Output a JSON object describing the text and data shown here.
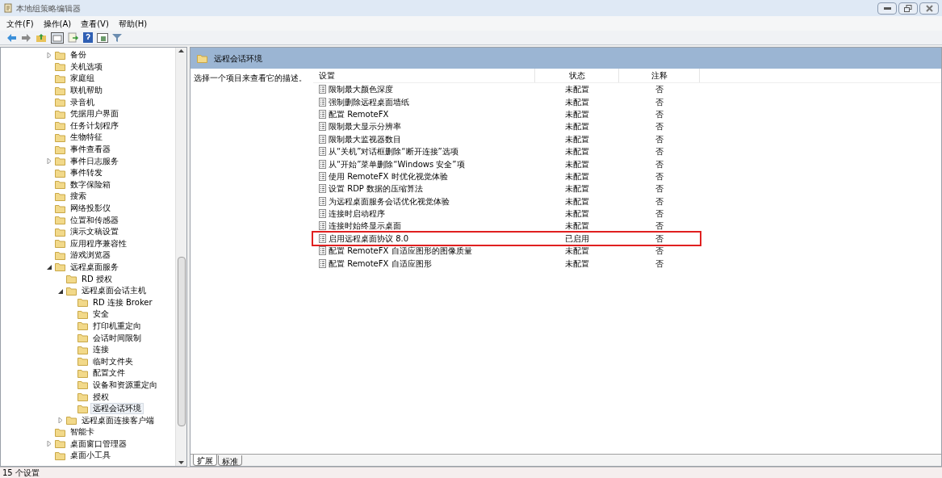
{
  "window": {
    "title": "本地组策略编辑器"
  },
  "menu": [
    "文件(F)",
    "操作(A)",
    "查看(V)",
    "帮助(H)"
  ],
  "tree": [
    {
      "label": "备份",
      "expandable": true,
      "expanded": false,
      "selected": false
    },
    {
      "label": "关机选项",
      "expandable": false,
      "selected": false
    },
    {
      "label": "家庭组",
      "expandable": false,
      "selected": false
    },
    {
      "label": "联机帮助",
      "expandable": false,
      "selected": false
    },
    {
      "label": "录音机",
      "expandable": false,
      "selected": false
    },
    {
      "label": "凭据用户界面",
      "expandable": false,
      "selected": false
    },
    {
      "label": "任务计划程序",
      "expandable": false,
      "selected": false
    },
    {
      "label": "生物特征",
      "expandable": false,
      "selected": false
    },
    {
      "label": "事件查看器",
      "expandable": false,
      "selected": false
    },
    {
      "label": "事件日志服务",
      "expandable": true,
      "expanded": false,
      "selected": false
    },
    {
      "label": "事件转发",
      "expandable": false,
      "selected": false
    },
    {
      "label": "数字保险箱",
      "expandable": false,
      "selected": false
    },
    {
      "label": "搜索",
      "expandable": false,
      "selected": false
    },
    {
      "label": "网络投影仪",
      "expandable": false,
      "selected": false
    },
    {
      "label": "位置和传感器",
      "expandable": false,
      "selected": false
    },
    {
      "label": "演示文稿设置",
      "expandable": false,
      "selected": false
    },
    {
      "label": "应用程序兼容性",
      "expandable": false,
      "selected": false
    },
    {
      "label": "游戏浏览器",
      "expandable": false,
      "selected": false
    },
    {
      "label": "远程桌面服务",
      "expandable": true,
      "expanded": true,
      "selected": false,
      "children": [
        {
          "label": "RD 授权",
          "expandable": false,
          "selected": false
        },
        {
          "label": "远程桌面会话主机",
          "expandable": true,
          "expanded": true,
          "selected": false,
          "children": [
            {
              "label": "RD 连接 Broker",
              "expandable": false,
              "selected": false
            },
            {
              "label": "安全",
              "expandable": false,
              "selected": false
            },
            {
              "label": "打印机重定向",
              "expandable": false,
              "selected": false
            },
            {
              "label": "会话时间限制",
              "expandable": false,
              "selected": false
            },
            {
              "label": "连接",
              "expandable": false,
              "selected": false
            },
            {
              "label": "临时文件夹",
              "expandable": false,
              "selected": false
            },
            {
              "label": "配置文件",
              "expandable": false,
              "selected": false
            },
            {
              "label": "设备和资源重定向",
              "expandable": false,
              "selected": false
            },
            {
              "label": "授权",
              "expandable": false,
              "selected": false
            },
            {
              "label": "远程会话环境",
              "expandable": false,
              "selected": true
            }
          ]
        },
        {
          "label": "远程桌面连接客户端",
          "expandable": true,
          "expanded": false,
          "selected": false
        }
      ]
    },
    {
      "label": "智能卡",
      "expandable": false,
      "selected": false
    },
    {
      "label": "桌面窗口管理器",
      "expandable": true,
      "expanded": false,
      "selected": false
    },
    {
      "label": "桌面小工具",
      "expandable": false,
      "selected": false
    }
  ],
  "pane": {
    "title": "远程会话环境",
    "description": "选择一个项目来查看它的描述。"
  },
  "table": {
    "columns": [
      "设置",
      "状态",
      "注释"
    ],
    "rows": [
      {
        "setting": "限制最大颜色深度",
        "state": "未配置",
        "comment": "否",
        "highlighted": false
      },
      {
        "setting": "强制删除远程桌面墙纸",
        "state": "未配置",
        "comment": "否",
        "highlighted": false
      },
      {
        "setting": "配置 RemoteFX",
        "state": "未配置",
        "comment": "否",
        "highlighted": false
      },
      {
        "setting": "限制最大显示分辨率",
        "state": "未配置",
        "comment": "否",
        "highlighted": false
      },
      {
        "setting": "限制最大监视器数目",
        "state": "未配置",
        "comment": "否",
        "highlighted": false
      },
      {
        "setting": "从“关机”对话框删除“断开连接”选项",
        "state": "未配置",
        "comment": "否",
        "highlighted": false
      },
      {
        "setting": "从“开始”菜单删除“Windows 安全”项",
        "state": "未配置",
        "comment": "否",
        "highlighted": false
      },
      {
        "setting": "使用 RemoteFX 时优化视觉体验",
        "state": "未配置",
        "comment": "否",
        "highlighted": false
      },
      {
        "setting": "设置 RDP 数据的压缩算法",
        "state": "未配置",
        "comment": "否",
        "highlighted": false
      },
      {
        "setting": "为远程桌面服务会话优化视觉体验",
        "state": "未配置",
        "comment": "否",
        "highlighted": false
      },
      {
        "setting": "连接时启动程序",
        "state": "未配置",
        "comment": "否",
        "highlighted": false
      },
      {
        "setting": "连接时始终显示桌面",
        "state": "未配置",
        "comment": "否",
        "highlighted": false
      },
      {
        "setting": "启用远程桌面协议 8.0",
        "state": "已启用",
        "comment": "否",
        "highlighted": true
      },
      {
        "setting": "配置 RemoteFX 自适应图形的图像质量",
        "state": "未配置",
        "comment": "否",
        "highlighted": false
      },
      {
        "setting": "配置 RemoteFX 自适应图形",
        "state": "未配置",
        "comment": "否",
        "highlighted": false
      }
    ]
  },
  "tabs": [
    {
      "label": "扩展",
      "selected": true
    },
    {
      "label": "标准",
      "selected": false
    }
  ],
  "status_bar": "15 个设置"
}
